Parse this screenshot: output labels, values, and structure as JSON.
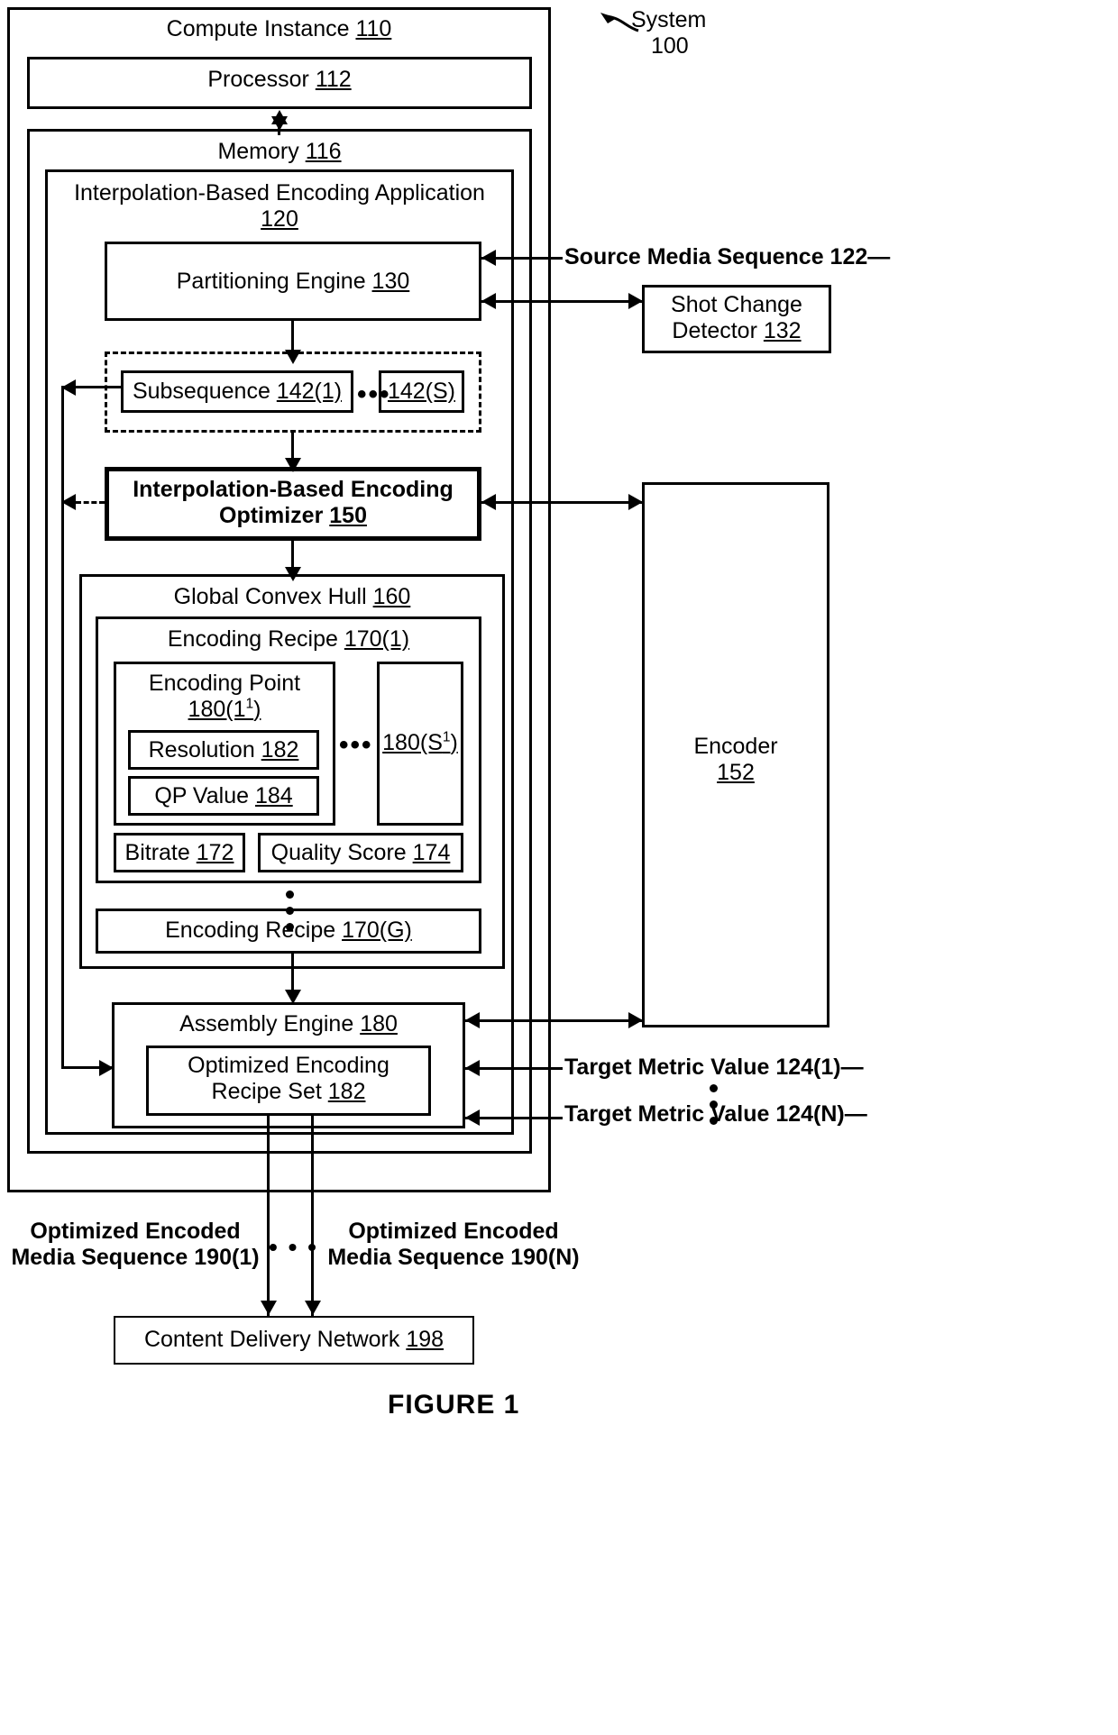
{
  "figure": {
    "caption": "FIGURE 1",
    "system_label_line1": "System",
    "system_label_line2": "100"
  },
  "compute_instance": {
    "title": "Compute Instance ",
    "ref": "110"
  },
  "processor": {
    "title": "Processor ",
    "ref": "112"
  },
  "memory": {
    "title": "Memory ",
    "ref": "116"
  },
  "application": {
    "title_line1": "Interpolation-Based Encoding Application",
    "ref": "120"
  },
  "partitioning_engine": {
    "title": "Partitioning Engine ",
    "ref": "130"
  },
  "shot_change_detector": {
    "title_line1": "Shot Change",
    "title_line2": "Detector ",
    "ref": "132"
  },
  "subsequences": {
    "first_label": "Subsequence ",
    "first_ref": "142(1)",
    "ellipsis": "•••",
    "last_ref": "142(S)"
  },
  "optimizer": {
    "title_line1": "Interpolation-Based Encoding",
    "title_line2": "Optimizer ",
    "ref": "150"
  },
  "encoder": {
    "title": "Encoder",
    "ref": "152"
  },
  "global_convex_hull": {
    "title": "Global Convex Hull ",
    "ref": "160"
  },
  "encoding_recipe_first": {
    "title": "Encoding Recipe ",
    "ref": "170(1)"
  },
  "encoding_recipe_last": {
    "title": "Encoding Recipe ",
    "ref": "170(G)"
  },
  "encoding_point": {
    "title": "Encoding Point",
    "ref_prefix": "180(1",
    "ref_sup": "1",
    "ref_suffix": ")",
    "ellipsis": "•••",
    "last_ref_prefix": "180(S",
    "last_ref_sup": "1",
    "last_ref_suffix": ")"
  },
  "resolution": {
    "title": "Resolution ",
    "ref": "182"
  },
  "qp_value": {
    "title": "QP Value ",
    "ref": "184"
  },
  "bitrate": {
    "title": "Bitrate ",
    "ref": "172"
  },
  "quality_score": {
    "title": "Quality Score ",
    "ref": "174"
  },
  "assembly_engine": {
    "title": "Assembly Engine ",
    "ref": "180"
  },
  "optimized_recipe_set": {
    "title_line1": "Optimized Encoding",
    "title_line2": "Recipe Set ",
    "ref": "182"
  },
  "source_media_sequence": {
    "label": "Source Media Sequence 122",
    "trailing_dash": "—"
  },
  "target_metric_values": {
    "first": "Target Metric Value 124(1)",
    "last": "Target Metric Value 124(N)",
    "trailing_dash": "—"
  },
  "outputs": {
    "first_line1": "Optimized Encoded",
    "first_line2": "Media Sequence 190(1)",
    "ellipsis": "• • •",
    "last_line1": "Optimized Encoded",
    "last_line2": "Media Sequence 190(N)"
  },
  "cdn": {
    "title": "Content Delivery Network ",
    "ref": "198"
  }
}
